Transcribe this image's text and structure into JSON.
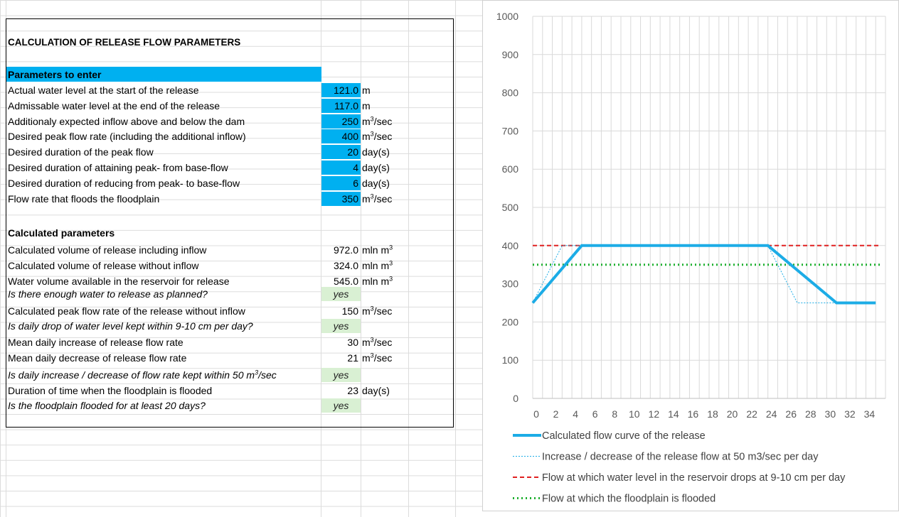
{
  "sheet": {
    "title": "CALCULATION OF RELEASE FLOW PARAMETERS",
    "params_header": "Parameters to enter",
    "params": [
      {
        "label": "Actual water level at the start of the release",
        "value": "121.0",
        "unit": "m"
      },
      {
        "label": "Admissable water level at the end of the release",
        "value": "117.0",
        "unit": "m"
      },
      {
        "label": "Additionaly expected inflow above and below the dam",
        "value": "250",
        "unit": "m3/sec"
      },
      {
        "label": "Desired peak flow rate (including the additional inflow)",
        "value": "400",
        "unit": "m3/sec"
      },
      {
        "label": "Desired duration of the peak flow",
        "value": "20",
        "unit": "day(s)"
      },
      {
        "label": "Desired duration of attaining peak- from base-flow",
        "value": "4",
        "unit": "day(s)"
      },
      {
        "label": "Desired duration of reducing from peak- to base-flow",
        "value": "6",
        "unit": "day(s)"
      },
      {
        "label": "Flow rate that floods the floodplain",
        "value": "350",
        "unit": "m3/sec"
      }
    ],
    "calc_header": "Calculated parameters",
    "calc": [
      {
        "label": "Calculated volume of release including inflow",
        "value": "972.0",
        "unit": "mln m3",
        "kind": "num"
      },
      {
        "label": "Calculated volume of release without inflow",
        "value": "324.0",
        "unit": "mln m3",
        "kind": "num"
      },
      {
        "label": "Water volume available in the reservoir for release",
        "value": "545.0",
        "unit": "mln m3",
        "kind": "num"
      },
      {
        "label": "Is there enough water to release as planned?",
        "value": "yes",
        "unit": "",
        "kind": "yes"
      },
      {
        "label": "Calculated peak flow rate of the release without inflow",
        "value": "150",
        "unit": "m3/sec",
        "kind": "num"
      },
      {
        "label": "Is daily drop of water level kept within 9-10 cm per day?",
        "value": "yes",
        "unit": "",
        "kind": "yes"
      },
      {
        "label": "Mean daily increase of release flow rate",
        "value": "30",
        "unit": "m3/sec",
        "kind": "num"
      },
      {
        "label": "Mean daily decrease of release flow rate",
        "value": "21",
        "unit": "m3/sec",
        "kind": "num"
      },
      {
        "label": "Is daily increase / decrease of flow rate kept within  50 m3/sec",
        "value": "yes",
        "unit": "",
        "kind": "yes"
      },
      {
        "label": "Duration of time when the floodplain is flooded",
        "value": "23",
        "unit": "day(s)",
        "kind": "num"
      },
      {
        "label": "Is the floodplain flooded for at least 20 days?",
        "value": "yes",
        "unit": "",
        "kind": "yes"
      }
    ]
  },
  "colors": {
    "input_fill": "#00b0f0",
    "yes_fill": "#d9f0d3",
    "curve": "#1cace6",
    "ramp": "#1cace6",
    "level_line": "#e02020",
    "flood_line": "#1fb030"
  },
  "chart_data": {
    "type": "line",
    "x_ticks": [
      0,
      2,
      4,
      6,
      8,
      10,
      12,
      14,
      16,
      18,
      20,
      22,
      24,
      26,
      28,
      30,
      32,
      34
    ],
    "xlim": [
      0,
      36
    ],
    "y_ticks": [
      0,
      100,
      200,
      300,
      400,
      500,
      600,
      700,
      800,
      900,
      1000
    ],
    "ylim": [
      0,
      1000
    ],
    "grid": true,
    "legend_position": "bottom",
    "series": [
      {
        "name": "Calculated flow curve of the release",
        "style": "solid-thick",
        "points": [
          [
            0,
            250
          ],
          [
            5,
            400
          ],
          [
            24,
            400
          ],
          [
            31,
            250
          ],
          [
            35,
            250
          ]
        ]
      },
      {
        "name": "Increase / decrease of the release flow at 50 m3/sec per day",
        "style": "dotted-thin",
        "points": [
          [
            0,
            250
          ],
          [
            3,
            400
          ],
          [
            24,
            400
          ],
          [
            27,
            250
          ],
          [
            31,
            250
          ]
        ]
      },
      {
        "name": "Flow at which water level in the reservoir drops at 9-10 cm per day",
        "style": "dashed-red",
        "points": [
          [
            0,
            400
          ],
          [
            35.5,
            400
          ]
        ]
      },
      {
        "name": "Flow at which the floodplain is flooded",
        "style": "dotted-green",
        "points": [
          [
            0,
            350
          ],
          [
            35.5,
            350
          ]
        ]
      }
    ]
  }
}
